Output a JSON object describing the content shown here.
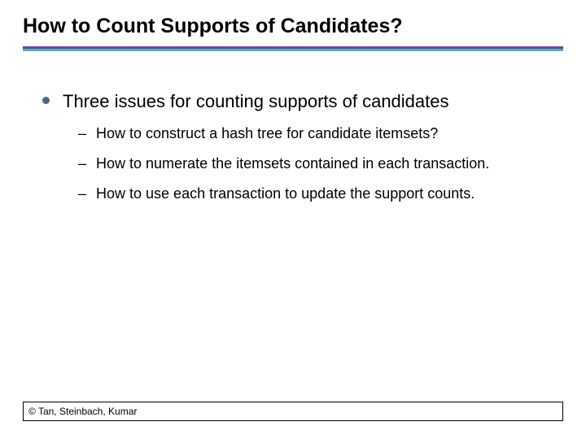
{
  "title": "How to Count Supports of Candidates?",
  "main": {
    "lead": "Three issues for counting supports of candidates",
    "sub": [
      "How to construct a hash tree for candidate itemsets?",
      "How to numerate the itemsets contained in each transaction.",
      "How to use each transaction to update the support counts."
    ]
  },
  "footer": "© Tan, Steinbach, Kumar"
}
